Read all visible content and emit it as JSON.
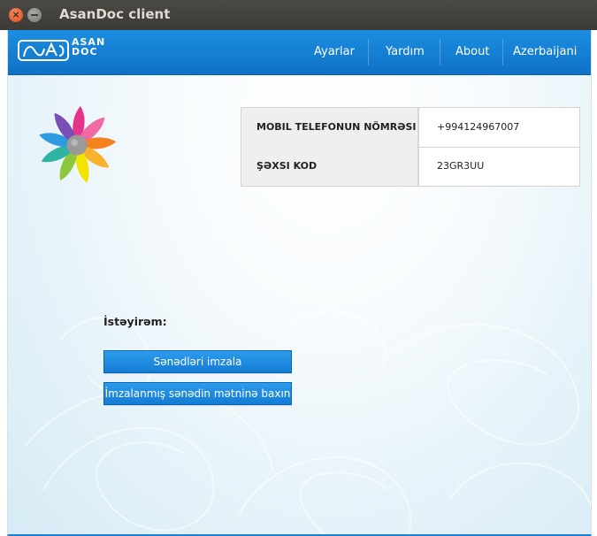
{
  "window": {
    "title": "AsanDoc client"
  },
  "navbar": {
    "logo_text_line1": "ASAN",
    "logo_text_line2": "DOC",
    "items": [
      {
        "label": "Ayarlar"
      },
      {
        "label": "Yardım"
      },
      {
        "label": "About"
      },
      {
        "label": "Azerbaijani"
      }
    ],
    "accent_color": "#1283d8"
  },
  "info": {
    "rows": [
      {
        "key": "MOBIL TELEFONUN NÖMRƏSI",
        "value": "+994124967007"
      },
      {
        "key": "ŞƏXSI KOD",
        "value": "23GR3UU"
      }
    ]
  },
  "actions": {
    "prompt": "İstəyirəm:",
    "sign_button": "Sənədləri imzala",
    "view_button": "İmzalanmış sənədin mətninə baxın"
  },
  "icons": [
    "close-icon",
    "minimize-icon",
    "asan-doc-logo-icon",
    "chevron-down-icon",
    "asan-flower-logo-icon"
  ]
}
